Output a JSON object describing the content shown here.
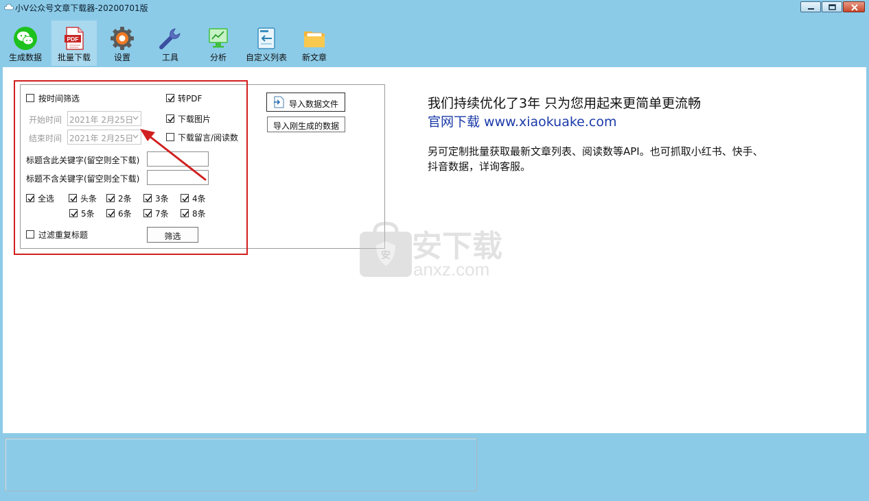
{
  "window": {
    "title": "小V公众号文章下载器-20200701版",
    "app_icon": "cloud-icon",
    "controls": [
      "minimize-icon",
      "maximize-icon",
      "close-icon"
    ]
  },
  "toolbar": {
    "items": [
      {
        "label": "生成数据",
        "icon": "wechat-icon",
        "active": false
      },
      {
        "label": "批量下载",
        "icon": "pdf-icon",
        "active": true
      },
      {
        "label": "设置",
        "icon": "gear-icon",
        "active": false
      },
      {
        "label": "工具",
        "icon": "wrench-icon",
        "active": false
      },
      {
        "label": "分析",
        "icon": "chart-monitor-icon",
        "active": false
      },
      {
        "label": "自定义列表",
        "icon": "import-list-icon",
        "active": false
      },
      {
        "label": "新文章",
        "icon": "folder-icon",
        "active": false
      }
    ]
  },
  "filters": {
    "time_filter": {
      "label": "按时间筛选",
      "checked": false
    },
    "start_label": "开始时间",
    "start_date": "2021年 2月25日",
    "end_label": "结束时间",
    "end_date": "2021年 2月25日",
    "include_keyword_label": "标题含此关键字(留空则全下载)",
    "include_keyword_value": "",
    "exclude_keyword_label": "标题不含关键字(留空则全下载)",
    "exclude_keyword_value": "",
    "to_pdf": {
      "label": "转PDF",
      "checked": true
    },
    "download_images": {
      "label": "下载图片",
      "checked": true
    },
    "download_comments": {
      "label": "下载留言/阅读数",
      "checked": false
    },
    "select_all": {
      "label": "全选",
      "checked": true
    },
    "positions": [
      {
        "label": "头条",
        "checked": true
      },
      {
        "label": "2条",
        "checked": true
      },
      {
        "label": "3条",
        "checked": true
      },
      {
        "label": "4条",
        "checked": true
      },
      {
        "label": "5条",
        "checked": true
      },
      {
        "label": "6条",
        "checked": true
      },
      {
        "label": "7条",
        "checked": true
      },
      {
        "label": "8条",
        "checked": true
      }
    ],
    "dedupe": {
      "label": "过滤重复标题",
      "checked": false
    },
    "filter_button": "筛选"
  },
  "actions": {
    "import_file": "导入数据文件",
    "import_generated": "导入刚生成的数据"
  },
  "info": {
    "promo": "我们持续优化了3年 只为您用起来更简单更流畅",
    "link": "官网下载 www.xiaokuake.com",
    "description": "另可定制批量获取最新文章列表、阅读数等API。也可抓取小红书、快手、抖音数据，详询客服。"
  },
  "watermark": {
    "text_cn": "安下载",
    "text_en": "anxz.com"
  },
  "colors": {
    "window_bg": "#8ccbe8",
    "highlight_border": "#d21d1d",
    "link": "#1a3aa8",
    "annotation_arrow": "#d02020"
  }
}
